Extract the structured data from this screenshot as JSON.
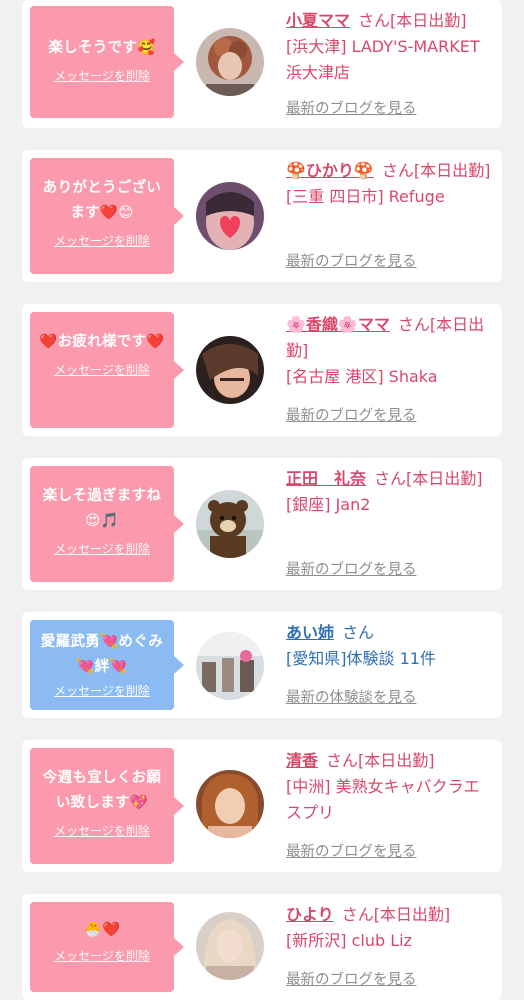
{
  "cards": [
    {
      "message": "楽しそうです🥰",
      "delete_label": "メッセージを削除",
      "name": "小夏ママ",
      "suffix": "さん[本日出勤]",
      "shop": "[浜大津] LADY'S-MARKET 浜大津店",
      "link": "最新のブログを見る",
      "bubble_color": "#fb9aac"
    },
    {
      "message": "ありがとうございます❤️😊",
      "delete_label": "メッセージを削除",
      "name": "🍄ひかり🍄",
      "suffix": "さん[本日出勤]",
      "shop": "[三重 四日市] Refuge",
      "link": "最新のブログを見る",
      "bubble_color": "#fb9aac"
    },
    {
      "message": "❤️お疲れ様です❤️",
      "delete_label": "メッセージを削除",
      "name": "🌸香織🌸ママ",
      "suffix": "さん[本日出勤]",
      "shop": "[名古屋 港区] Shaka",
      "link": "最新のブログを見る",
      "bubble_color": "#fb9aac"
    },
    {
      "message": "楽しそ過ぎますね😍🎵",
      "delete_label": "メッセージを削除",
      "name": "正田　礼奈",
      "suffix": "さん[本日出勤]",
      "shop": "[銀座] Jan2",
      "link": "最新のブログを見る",
      "bubble_color": "#fb9aac"
    },
    {
      "message": "愛羅武勇💘めぐみ💘絆💘",
      "delete_label": "メッセージを削除",
      "name": "あい姉",
      "suffix": "さん",
      "shop": "[愛知県]体験談 11件",
      "link": "最新の体験談を見る",
      "bubble_color": "#8cbbf4"
    },
    {
      "message": "今週も宜しくお願い致します💖",
      "delete_label": "メッセージを削除",
      "name": "清香",
      "suffix": "さん[本日出勤]",
      "shop": "[中洲] 美熟女キャバクラエスプリ",
      "link": "最新のブログを見る",
      "bubble_color": "#fb9aac"
    },
    {
      "message": "🐣❤️",
      "delete_label": "メッセージを削除",
      "name": "ひより",
      "suffix": "さん[本日出勤]",
      "shop": "[新所沢] club Liz",
      "link": "最新のブログを見る",
      "bubble_color": "#fb9aac"
    }
  ],
  "colors": {
    "name_pink": "#d8486a",
    "name_blue": "#2f6fb3",
    "link_gray": "#8f8f8f",
    "background": "#f1f1f1"
  }
}
